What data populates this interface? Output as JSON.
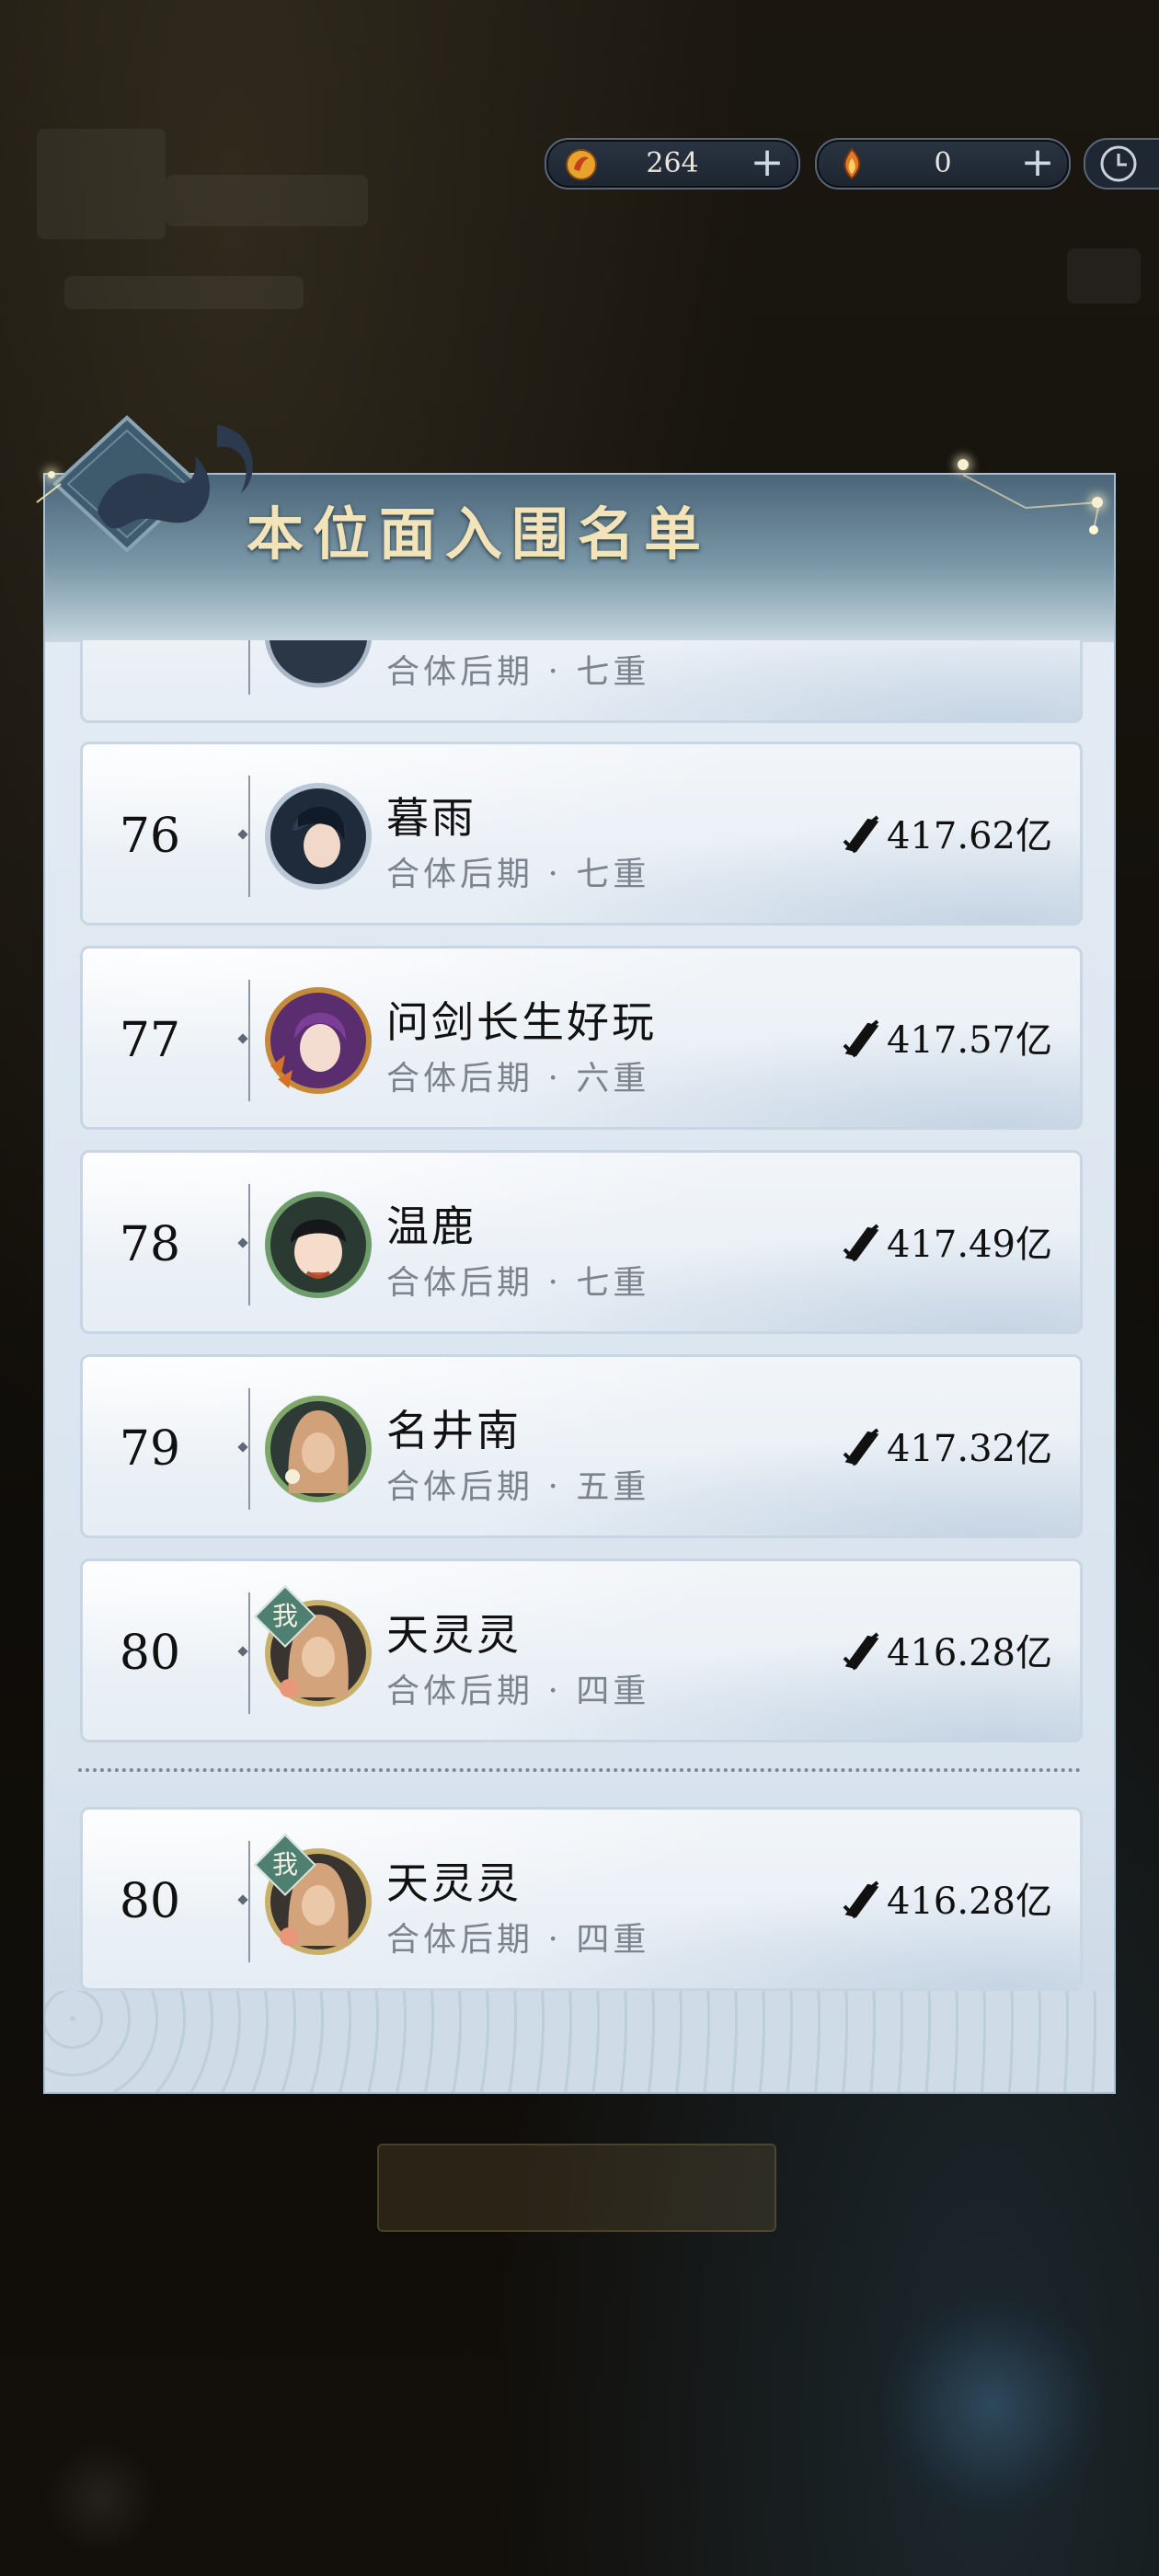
{
  "currency": {
    "spirit_stones": "264",
    "tokens": "0"
  },
  "panel": {
    "title": "本位面入围名单"
  },
  "entries": [
    {
      "rank": "",
      "name": "",
      "realm": "合体后期 · 七重",
      "power": ""
    },
    {
      "rank": "76",
      "name": "暮雨",
      "realm": "合体后期 · 七重",
      "power": "417.62亿"
    },
    {
      "rank": "77",
      "name": "问剑长生好玩",
      "realm": "合体后期 · 六重",
      "power": "417.57亿"
    },
    {
      "rank": "78",
      "name": "温鹿",
      "realm": "合体后期 · 七重",
      "power": "417.49亿"
    },
    {
      "rank": "79",
      "name": "名井南",
      "realm": "合体后期 · 五重",
      "power": "417.32亿"
    },
    {
      "rank": "80",
      "name": "天灵灵",
      "realm": "合体后期 · 四重",
      "power": "416.28亿",
      "badge": "我"
    }
  ],
  "self_entry": {
    "rank": "80",
    "name": "天灵灵",
    "realm": "合体后期 · 四重",
    "power": "416.28亿",
    "badge": "我"
  },
  "colors": {
    "title_gold": "#f2e4b8",
    "badge_green": "#4e7f70",
    "panel_bg": "#e4ecf4"
  }
}
